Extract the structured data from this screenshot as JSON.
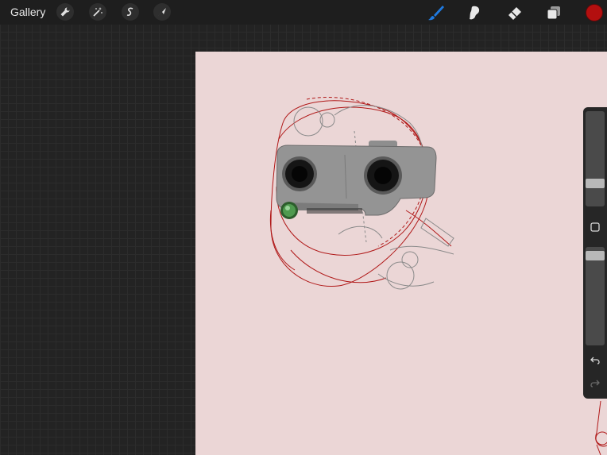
{
  "topbar": {
    "gallery_label": "Gallery",
    "left_tools": [
      "wrench-icon",
      "magic-wand-icon",
      "selection-icon",
      "transform-arrow-icon"
    ],
    "right_tools": [
      "brush-icon",
      "smudge-icon",
      "eraser-icon",
      "layers-icon"
    ],
    "active_tool": "brush",
    "active_tool_color": "#1f7ae0",
    "current_color": "#b30f0f"
  },
  "canvas": {
    "background_color": "#ebd6d6",
    "sketch_color": "#b01818"
  },
  "sidebar": {
    "brush_size_level": 0.6,
    "opacity_level": 0.3,
    "buttons": [
      "modify-square-icon",
      "undo-icon",
      "redo-icon"
    ]
  }
}
